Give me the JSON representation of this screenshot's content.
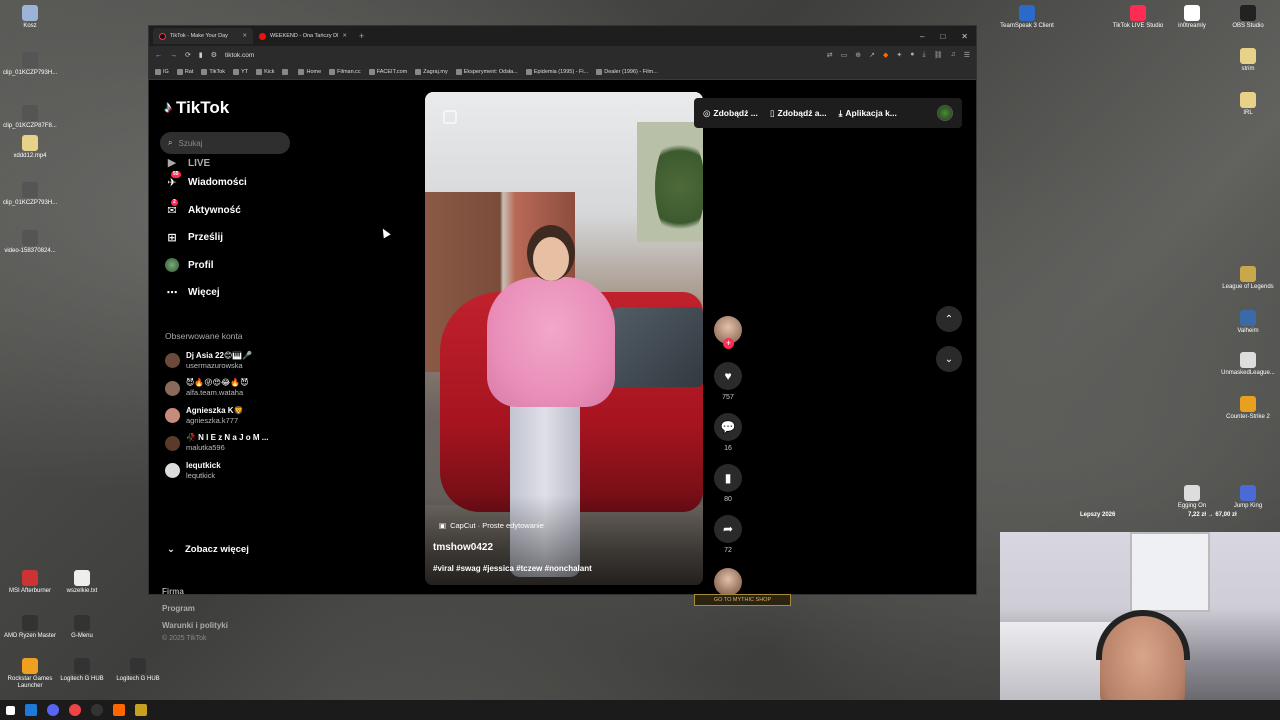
{
  "desktop": {
    "icons_left": [
      {
        "label": "Kosz",
        "color": "#9db4d8"
      },
      {
        "label": "clip_01KCZP793H...",
        "color": "#555"
      },
      {
        "label": "clip_01KCZP87F8...",
        "color": "#555"
      },
      {
        "label": "xddd12.mp4",
        "color": "#e8d28a"
      },
      {
        "label": "clip_01KCZP793H...",
        "color": "#555"
      },
      {
        "label": "video-158370824...",
        "color": "#555"
      },
      {
        "label": "MSI Afterburner",
        "color": "#c33"
      },
      {
        "label": "wszelkie.txt",
        "color": "#eee"
      },
      {
        "label": "AMD Ryzen Master",
        "color": "#333"
      },
      {
        "label": "G-Menu",
        "color": "#333"
      },
      {
        "label": "Rockstar Games Launcher",
        "color": "#f0a020"
      },
      {
        "label": "Logitech G HUB",
        "color": "#333"
      },
      {
        "label": "Logitech G HUB",
        "color": "#333"
      }
    ],
    "icons_right": [
      {
        "label": "TeamSpeak 3 Client",
        "color": "#2a6ac8"
      },
      {
        "label": "TikTok LIVE Studio",
        "color": "#fe2c55"
      },
      {
        "label": "in0treamly",
        "color": "#fff"
      },
      {
        "label": "OBS Studio",
        "color": "#222"
      },
      {
        "label": "strim",
        "color": "#e8d28a"
      },
      {
        "label": "IRL",
        "color": "#e8d28a"
      },
      {
        "label": "League of Legends",
        "color": "#c8a84a"
      },
      {
        "label": "Valheim",
        "color": "#3a6aa8"
      },
      {
        "label": "UnmaskedLeague...",
        "color": "#ddd"
      },
      {
        "label": "Counter-Strike 2",
        "color": "#e8a020"
      },
      {
        "label": "Egging On",
        "color": "#ddd"
      },
      {
        "label": "Jump King",
        "color": "#4a6ad8"
      }
    ]
  },
  "browser": {
    "tabs": [
      {
        "label": "TikTok - Make Your Day",
        "active": true
      },
      {
        "label": "WEEKEND - Ona Tańczy Dla Mnie - O...",
        "active": false
      }
    ],
    "new_tab": "+",
    "url": "tiktok.com",
    "window_controls": [
      "–",
      "□",
      "✕"
    ],
    "bookmarks": [
      "IG",
      "Rat",
      "TikTok",
      "YT",
      "Kick",
      "",
      "Home",
      "Filman.cc",
      "FACEIT.com",
      "Zagraj.my",
      "Eksperyment: Odsła...",
      "Epidemia (1995) - Fi...",
      "Dealer (1996) - Film..."
    ]
  },
  "tiktok": {
    "logo": "TikTok",
    "search_placeholder": "Szukaj",
    "nav": [
      {
        "label": "LIVE",
        "icon": "live-icon",
        "badge": ""
      },
      {
        "label": "Wiadomości",
        "icon": "messages-icon",
        "badge": "55"
      },
      {
        "label": "Aktywność",
        "icon": "activity-icon",
        "badge": "2"
      },
      {
        "label": "Prześlij",
        "icon": "upload-icon",
        "badge": ""
      },
      {
        "label": "Profil",
        "icon": "profile-icon",
        "badge": ""
      },
      {
        "label": "Więcej",
        "icon": "more-icon",
        "badge": ""
      }
    ],
    "followed_title": "Obserwowane konta",
    "followed": [
      {
        "name": "Dj Asia 22😊🎹🎤",
        "handle": "usermazurowska",
        "color": "#6a4a3a"
      },
      {
        "name": "😈🔥😜😍😂🔥😈",
        "handle": "alfa.team.wataha",
        "color": "#8a6a5a"
      },
      {
        "name": "Agnieszka K🦁",
        "handle": "agnieszka.k777",
        "color": "#c88a7a"
      },
      {
        "name": "🥀 N I E z N a J o M ...",
        "handle": "malutka596",
        "color": "#5a3a2a"
      },
      {
        "name": "lequtkick",
        "handle": "lequtkick",
        "color": "#ddd"
      }
    ],
    "see_more": "Zobacz więcej",
    "footer": [
      "Firma",
      "Program",
      "Warunki i polityki"
    ],
    "copyright": "© 2025 TikTok",
    "topbar": [
      "Zdobądź ...",
      "Zdobądź a...",
      "Aplikacja k..."
    ],
    "video": {
      "capcut": "CapCut · Proste edytowanie",
      "username": "tmshow0422",
      "tags": "#viral #swag #jessica #tczew #nonchalant"
    },
    "actions": {
      "likes": "757",
      "comments": "16",
      "saves": "80",
      "shares": "72"
    }
  },
  "overlay": {
    "mythic": "GO TO MYTHIC SHOP",
    "stream_left": "Lepszy 2026",
    "stream_right": "7,22 zł → 67,00 zł"
  }
}
